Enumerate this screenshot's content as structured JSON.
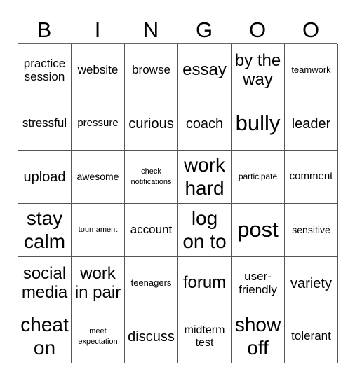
{
  "header": [
    "B",
    "I",
    "N",
    "G",
    "O",
    "O"
  ],
  "cells": [
    [
      "practice session",
      "website",
      "browse",
      "essay",
      "by the way",
      "teamwork"
    ],
    [
      "stressful",
      "pressure",
      "curious",
      "coach",
      "bully",
      "leader"
    ],
    [
      "upload",
      "awesome",
      "check notifications",
      "work hard",
      "participate",
      "comment"
    ],
    [
      "stay calm",
      "tournament",
      "account",
      "log on to",
      "post",
      "sensitive"
    ],
    [
      "social media",
      "work in pair",
      "teenagers",
      "forum",
      "user-friendly",
      "variety"
    ],
    [
      "cheat on",
      "meet expectation",
      "discuss",
      "midterm test",
      "show off",
      "tolerant"
    ]
  ]
}
